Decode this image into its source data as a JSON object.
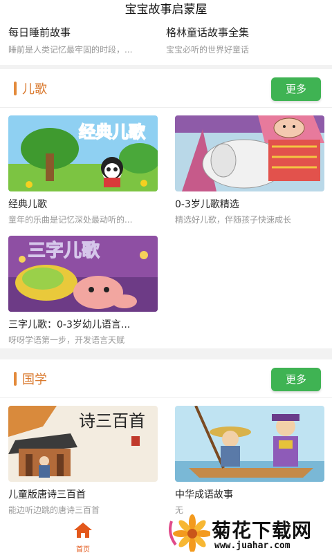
{
  "header": {
    "title": "宝宝故事启蒙屋"
  },
  "stories": [
    {
      "title": "每日睡前故事",
      "desc": "睡前是人类记忆最牢固的时段，..."
    },
    {
      "title": "格林童话故事全集",
      "desc": "宝宝必听的世界好童话"
    }
  ],
  "sections": [
    {
      "title": "儿歌",
      "more_label": "更多",
      "items": [
        {
          "title": "经典儿歌",
          "desc": "童年的乐曲是记忆深处最动听的...",
          "thumb_text": "经典儿歌"
        },
        {
          "title": "0-3岁儿歌精选",
          "desc": "精选好儿歌，伴随孩子快速成长"
        },
        {
          "title": "三字儿歌：0-3岁幼儿语言...",
          "desc": "呀呀学语第一步，开发语言天赋",
          "thumb_text": "三字儿歌"
        }
      ]
    },
    {
      "title": "国学",
      "more_label": "更多",
      "items": [
        {
          "title": "儿童版唐诗三百首",
          "desc": "能边听边跳的唐诗三百首",
          "thumb_text": "诗三百首"
        },
        {
          "title": "中华成语故事",
          "desc": "无"
        }
      ]
    }
  ],
  "tabbar": {
    "home_label": "首页"
  },
  "watermark": {
    "name": "菊花下载网",
    "url": "www.juahar.com"
  },
  "colors": {
    "accent_orange": "#d9782c",
    "button_green": "#3fb353",
    "tab_active": "#e3581b"
  }
}
